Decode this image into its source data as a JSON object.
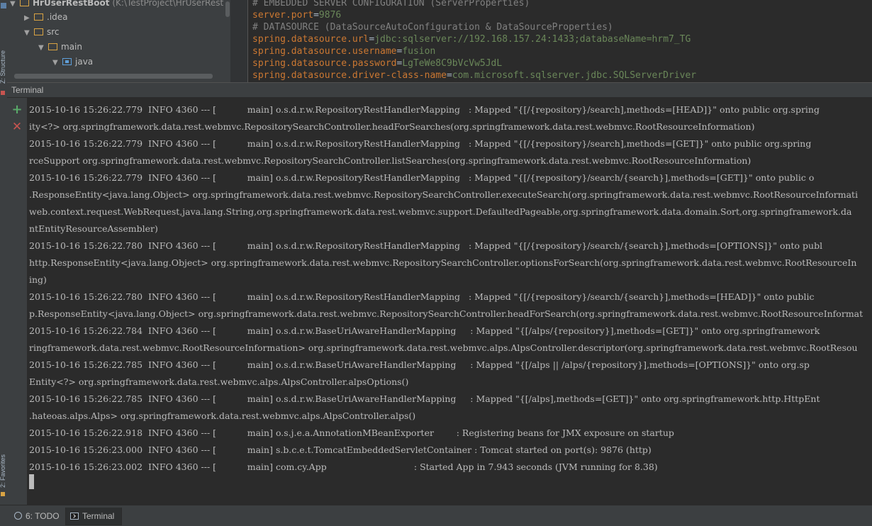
{
  "sidebar": {
    "structure_label": "Z: Structure",
    "favorites_label": "2: Favorites"
  },
  "project_tree": {
    "root_name": "HrUserRestBoot",
    "root_path": "(K:\\TestProject\\HrUserRestBc",
    "items": [
      {
        "label": ".idea"
      },
      {
        "label": "src"
      },
      {
        "label": "main"
      },
      {
        "label": "java"
      }
    ]
  },
  "editor": {
    "lines": [
      {
        "type": "comment",
        "text": "# EMBEDDED SERVER CONFIGURATION (ServerProperties)"
      },
      {
        "type": "prop",
        "key": "server.port",
        "value": "9876"
      },
      {
        "type": "comment",
        "text": "# DATASOURCE (DataSourceAutoConfiguration & DataSourceProperties)"
      },
      {
        "type": "prop",
        "key": "spring.datasource.url",
        "value": "jdbc:sqlserver://192.168.157.24:1433;databaseName=hrm7_TG"
      },
      {
        "type": "prop",
        "key": "spring.datasource.username",
        "value": "fusion"
      },
      {
        "type": "prop",
        "key": "spring.datasource.password",
        "value": "LgTeWe8C9bVcVw5JdL"
      },
      {
        "type": "prop",
        "key": "spring.datasource.driver-class-name",
        "value": "com.microsoft.sqlserver.jdbc.SQLServerDriver"
      }
    ]
  },
  "terminal": {
    "title": "Terminal",
    "add_button": "+",
    "close_button": "✕",
    "lines": [
      "2015-10-16 15:26:22.779  INFO 4360 --- [           main] o.s.d.r.w.RepositoryRestHandlerMapping   : Mapped \"{[/{repository}/search],methods=[HEAD]}\" onto public org.spring",
      "ity<?> org.springframework.data.rest.webmvc.RepositorySearchController.headForSearches(org.springframework.data.rest.webmvc.RootResourceInformation)",
      "2015-10-16 15:26:22.779  INFO 4360 --- [           main] o.s.d.r.w.RepositoryRestHandlerMapping   : Mapped \"{[/{repository}/search],methods=[GET]}\" onto public org.spring",
      "rceSupport org.springframework.data.rest.webmvc.RepositorySearchController.listSearches(org.springframework.data.rest.webmvc.RootResourceInformation)",
      "2015-10-16 15:26:22.779  INFO 4360 --- [           main] o.s.d.r.w.RepositoryRestHandlerMapping   : Mapped \"{[/{repository}/search/{search}],methods=[GET]}\" onto public o",
      ".ResponseEntity<java.lang.Object> org.springframework.data.rest.webmvc.RepositorySearchController.executeSearch(org.springframework.data.rest.webmvc.RootResourceInformati",
      "web.context.request.WebRequest,java.lang.String,org.springframework.data.rest.webmvc.support.DefaultedPageable,org.springframework.data.domain.Sort,org.springframework.da",
      "ntEntityResourceAssembler)",
      "2015-10-16 15:26:22.780  INFO 4360 --- [           main] o.s.d.r.w.RepositoryRestHandlerMapping   : Mapped \"{[/{repository}/search/{search}],methods=[OPTIONS]}\" onto publ",
      "http.ResponseEntity<java.lang.Object> org.springframework.data.rest.webmvc.RepositorySearchController.optionsForSearch(org.springframework.data.rest.webmvc.RootResourceIn",
      "ing)",
      "2015-10-16 15:26:22.780  INFO 4360 --- [           main] o.s.d.r.w.RepositoryRestHandlerMapping   : Mapped \"{[/{repository}/search/{search}],methods=[HEAD]}\" onto public ",
      "p.ResponseEntity<java.lang.Object> org.springframework.data.rest.webmvc.RepositorySearchController.headForSearch(org.springframework.data.rest.webmvc.RootResourceInformat",
      "2015-10-16 15:26:22.784  INFO 4360 --- [           main] o.s.d.r.w.BaseUriAwareHandlerMapping     : Mapped \"{[/alps/{repository}],methods=[GET]}\" onto org.springframework",
      "ringframework.data.rest.webmvc.RootResourceInformation> org.springframework.data.rest.webmvc.alps.AlpsController.descriptor(org.springframework.data.rest.webmvc.RootResou",
      "2015-10-16 15:26:22.785  INFO 4360 --- [           main] o.s.d.r.w.BaseUriAwareHandlerMapping     : Mapped \"{[/alps || /alps/{repository}],methods=[OPTIONS]}\" onto org.sp",
      "Entity<?> org.springframework.data.rest.webmvc.alps.AlpsController.alpsOptions()",
      "2015-10-16 15:26:22.785  INFO 4360 --- [           main] o.s.d.r.w.BaseUriAwareHandlerMapping     : Mapped \"{[/alps],methods=[GET]}\" onto org.springframework.http.HttpEnt",
      ".hateoas.alps.Alps> org.springframework.data.rest.webmvc.alps.AlpsController.alps()",
      "2015-10-16 15:26:22.918  INFO 4360 --- [           main] o.s.j.e.a.AnnotationMBeanExporter        : Registering beans for JMX exposure on startup",
      "2015-10-16 15:26:23.000  INFO 4360 --- [           main] s.b.c.e.t.TomcatEmbeddedServletContainer : Tomcat started on port(s): 9876 (http)",
      "2015-10-16 15:26:23.002  INFO 4360 --- [           main] com.cy.App                               : Started App in 7.943 seconds (JVM running for 8.38)"
    ]
  },
  "bottom_tabs": [
    {
      "label": "6: TODO"
    },
    {
      "label": "Terminal"
    }
  ],
  "colors": {
    "comment": "#808080",
    "key": "#cc7832",
    "value": "#6a8759",
    "add": "#59a869",
    "close": "#c75450"
  }
}
